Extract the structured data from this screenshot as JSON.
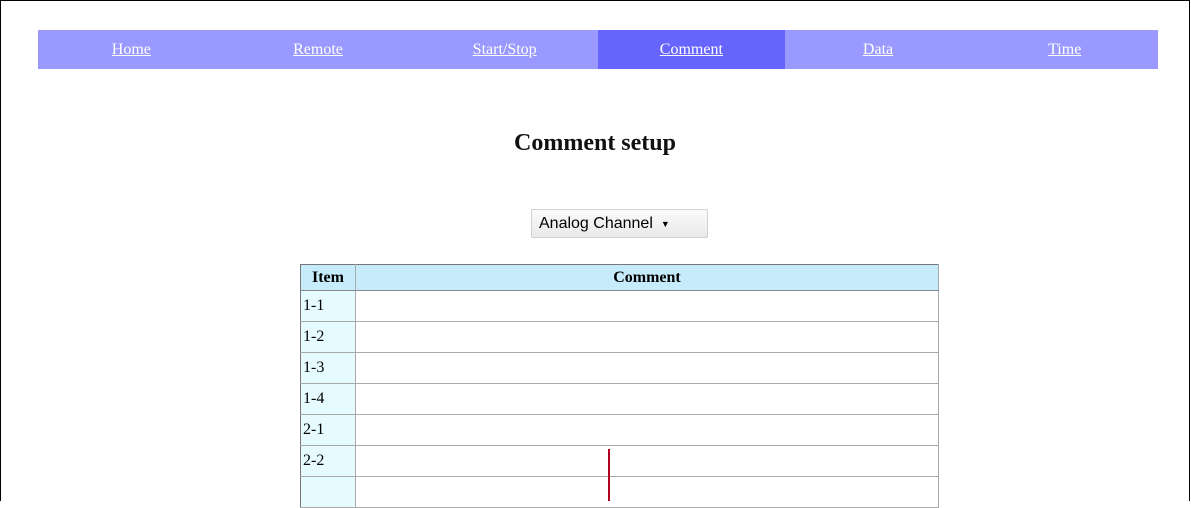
{
  "nav": {
    "items": [
      {
        "label": "Home"
      },
      {
        "label": "Remote"
      },
      {
        "label": "Start/Stop"
      },
      {
        "label": "Comment",
        "active": true
      },
      {
        "label": "Data"
      },
      {
        "label": "Time"
      }
    ]
  },
  "page": {
    "title": "Comment setup"
  },
  "channel_select": {
    "value": "Analog Channel"
  },
  "table": {
    "headers": {
      "item": "Item",
      "comment": "Comment"
    },
    "rows": [
      {
        "item": "1-1",
        "comment": ""
      },
      {
        "item": "1-2",
        "comment": ""
      },
      {
        "item": "1-3",
        "comment": ""
      },
      {
        "item": "1-4",
        "comment": ""
      },
      {
        "item": "2-1",
        "comment": ""
      },
      {
        "item": "2-2",
        "comment": ""
      },
      {
        "item": "",
        "comment": ""
      }
    ]
  },
  "colors": {
    "nav_bg": "#9999ff",
    "nav_active": "#6666ff",
    "header_bg": "#c6ecfb",
    "item_bg": "#e6fbff"
  }
}
